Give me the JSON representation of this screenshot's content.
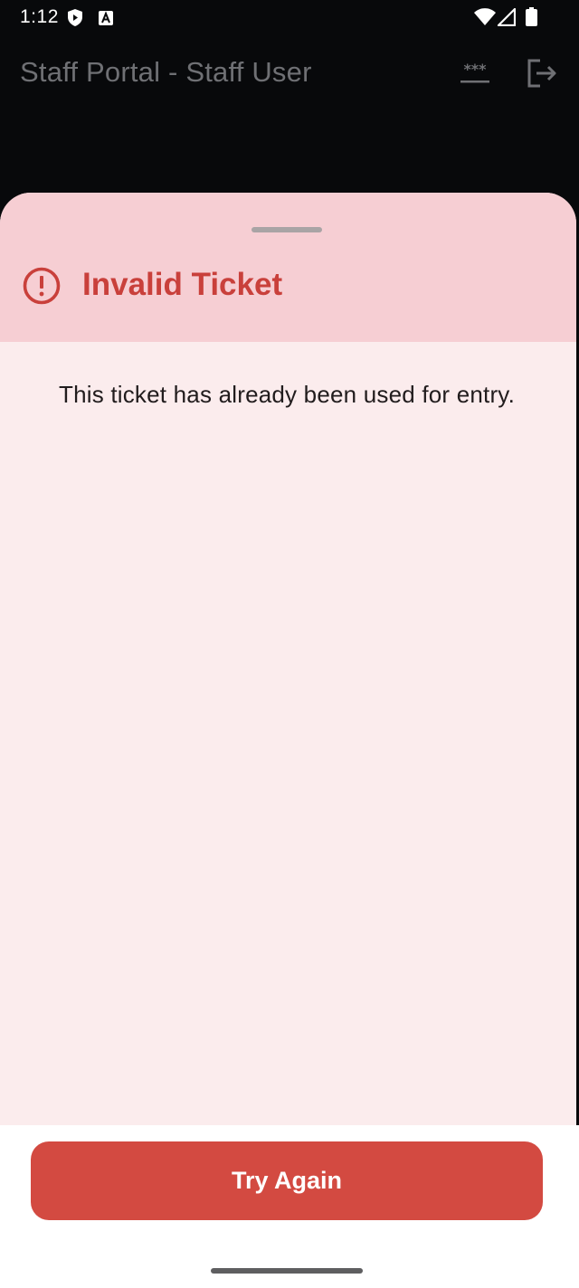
{
  "status_bar": {
    "time": "1:12",
    "icons": [
      "shield-icon",
      "a-notification-icon",
      "wifi-icon",
      "signal-icon",
      "battery-icon"
    ]
  },
  "app_bar": {
    "title": "Staff Portal - Staff User",
    "actions": [
      "password-icon",
      "logout-icon"
    ]
  },
  "sheet": {
    "title": "Invalid Ticket",
    "message": "This ticket has already been used for entry.",
    "icon": "alert-circle-icon"
  },
  "actions": {
    "try_again_label": "Try Again"
  },
  "colors": {
    "background": "#08090b",
    "sheet_header": "#f6ced3",
    "sheet_body": "#fbeced",
    "error_text": "#c9403b",
    "button": "#d34a41",
    "app_title": "#6f7074"
  }
}
